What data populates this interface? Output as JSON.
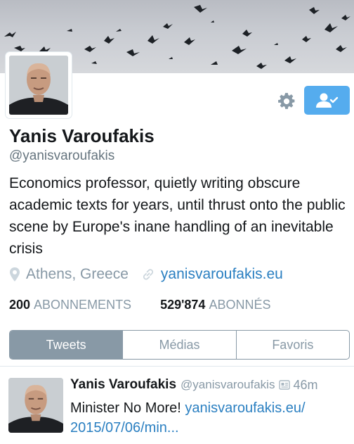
{
  "profile": {
    "name": "Yanis Varoufakis",
    "handle": "@yanisvaroufakis",
    "bio": "Economics professor, quietly writing obscure academic texts for years, until thrust onto the public scene by Europe's inane handling of an inevitable crisis",
    "location": "Athens, Greece",
    "url": "yanisvaroufakis.eu",
    "following_count": "200",
    "following_label": "ABONNEMENTS",
    "followers_count": "529'874",
    "followers_label": "ABONNÉS"
  },
  "buttons": {
    "settings_icon": "gear-icon",
    "follow_icon": "user-check-icon",
    "follow_color": "#55acee"
  },
  "tabs": [
    {
      "label": "Tweets",
      "active": true
    },
    {
      "label": "Médias",
      "active": false
    },
    {
      "label": "Favoris",
      "active": false
    }
  ],
  "tweet": {
    "name": "Yanis Varoufakis",
    "handle": "@yanisvaroufakis",
    "time": "46m",
    "text_plain": "Minister No More! ",
    "link_text": "yanisvaroufakis.eu/ 2015/07/06/min..."
  },
  "colors": {
    "accent": "#55acee",
    "link": "#2a7fc1",
    "muted": "#8899a6"
  }
}
